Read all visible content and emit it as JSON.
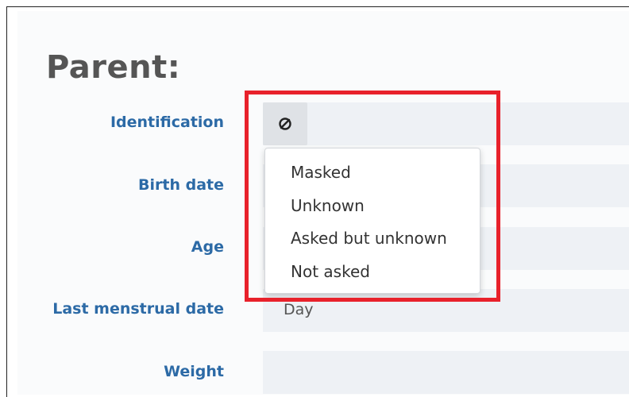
{
  "form": {
    "section_title": "Parent:",
    "fields": [
      {
        "label": "Identification"
      },
      {
        "label": "Birth date"
      },
      {
        "label": "Age"
      },
      {
        "label": "Last menstrual date",
        "value": "Day"
      },
      {
        "label": "Weight"
      }
    ]
  },
  "null_flavor": {
    "icon": "null-symbol-icon",
    "menu_items": [
      "Masked",
      "Unknown",
      "Asked but unknown",
      "Not asked"
    ]
  },
  "colors": {
    "label": "#2c6aa6",
    "title": "#555555",
    "field_bg": "#eef1f5",
    "highlight": "#e8212b"
  }
}
